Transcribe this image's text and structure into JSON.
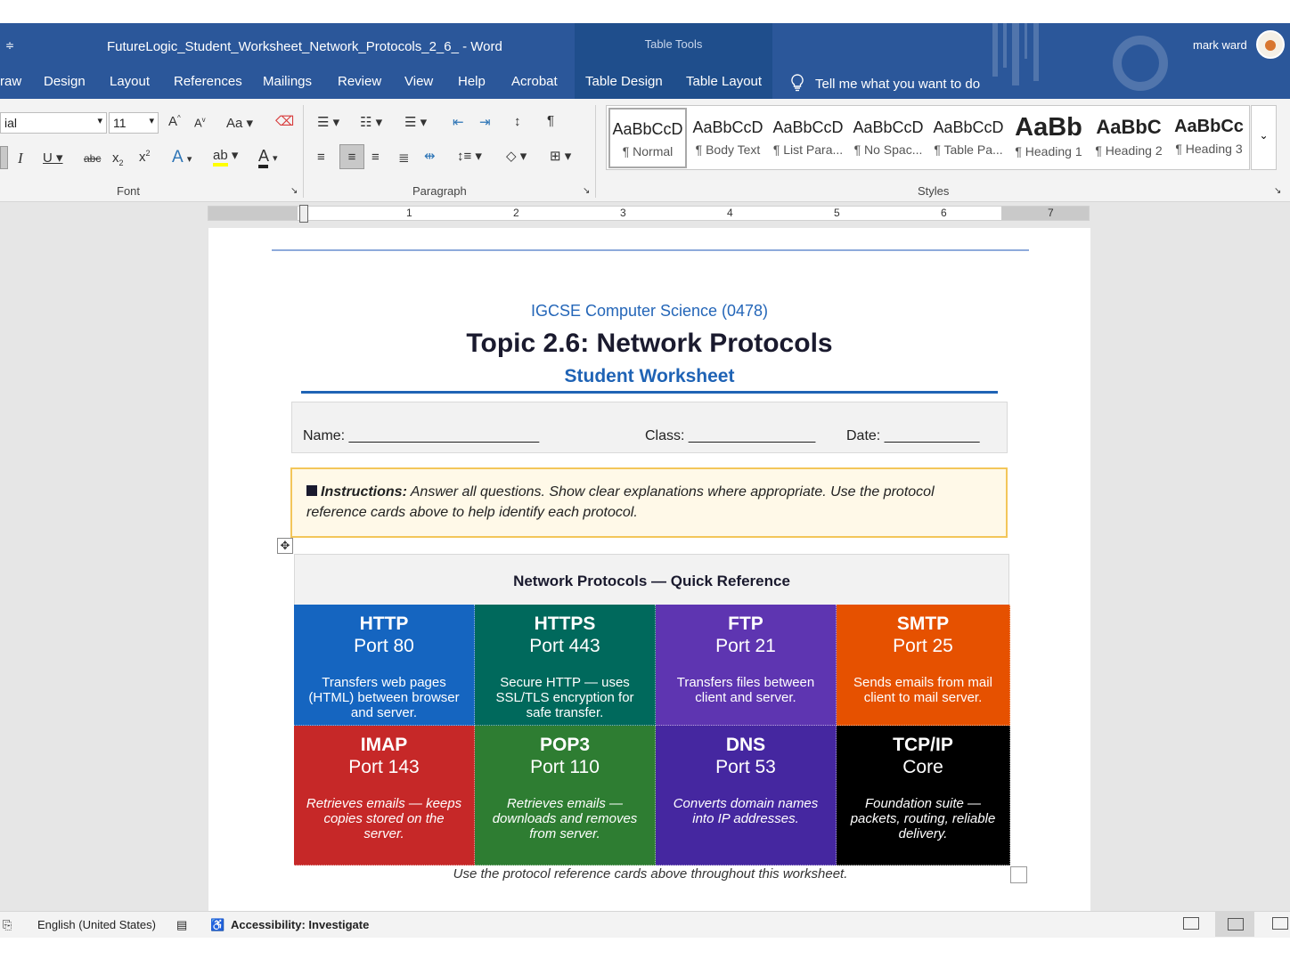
{
  "window": {
    "title": "FutureLogic_Student_Worksheet_Network_Protocols_2_6_  -  Word",
    "user": "mark ward",
    "table_tools": "Table Tools",
    "qat_glyph": "≑"
  },
  "tabs": [
    "raw",
    "Design",
    "Layout",
    "References",
    "Mailings",
    "Review",
    "View",
    "Help",
    "Acrobat",
    "Table Design",
    "Table Layout"
  ],
  "tell_me": "Tell me what you want to do",
  "ribbon": {
    "font_name": "ial",
    "font_size": "11",
    "groups": {
      "font": "Font",
      "paragraph": "Paragraph",
      "styles": "Styles"
    },
    "styles": [
      {
        "sample": "AaBbCcD",
        "name": "¶ Normal"
      },
      {
        "sample": "AaBbCcD",
        "name": "¶ Body Text"
      },
      {
        "sample": "AaBbCcD",
        "name": "¶ List Para..."
      },
      {
        "sample": "AaBbCcD",
        "name": "¶ No Spac..."
      },
      {
        "sample": "AaBbCcD",
        "name": "¶ Table Pa..."
      },
      {
        "sample": "AaBb",
        "name": "¶ Heading 1"
      },
      {
        "sample": "AaBbC",
        "name": "¶ Heading 2"
      },
      {
        "sample": "AaBbCc",
        "name": "¶ Heading 3"
      }
    ]
  },
  "ruler": [
    "1",
    "2",
    "3",
    "4",
    "5",
    "6",
    "7"
  ],
  "document": {
    "subject": "IGCSE Computer Science (0478)",
    "topic": "Topic 2.6: Network Protocols",
    "worksheet": "Student Worksheet",
    "name_label": "Name: ________________________",
    "class_label": "Class: ________________",
    "date_label": "Date: ____________",
    "instructions_bold": "Instructions:",
    "instructions_text": " Answer all questions. Show clear explanations where appropriate. Use the protocol reference cards above to help identify each protocol.",
    "quick_ref_title": "Network Protocols — Quick Reference",
    "cards": [
      {
        "name": "HTTP",
        "port": "Port 80",
        "desc": "Transfers web pages (HTML) between  browser and server.",
        "color": "#1565c0"
      },
      {
        "name": "HTTPS",
        "port": "Port 443",
        "desc": "Secure HTTP — uses SSL/TLS  encryption for safe transfer.",
        "color": "#00695c"
      },
      {
        "name": "FTP",
        "port": "Port 21",
        "desc": "Transfers files between client and server.",
        "color": "#5e35b1"
      },
      {
        "name": "SMTP",
        "port": "Port 25",
        "desc": "Sends emails from mail client to mail  server.",
        "color": "#e65100"
      },
      {
        "name": "IMAP",
        "port": "Port 143",
        "desc": "Retrieves emails — keeps copies stored on the server.",
        "color": "#c62828"
      },
      {
        "name": "POP3",
        "port": "Port 110",
        "desc": "Retrieves emails — downloads and removes from server.",
        "color": "#2e7d32"
      },
      {
        "name": "DNS",
        "port": "Port 53",
        "desc": "Converts domain names into IP addresses.",
        "color": "#4527a0"
      },
      {
        "name": "TCP/IP",
        "port": "Core",
        "desc": "Foundation suite — packets, routing, reliable delivery.",
        "color": "#000000"
      }
    ],
    "caption": "Use the protocol reference cards above throughout this worksheet."
  },
  "status": {
    "language": "English (United States)",
    "accessibility": "Accessibility: Investigate"
  }
}
